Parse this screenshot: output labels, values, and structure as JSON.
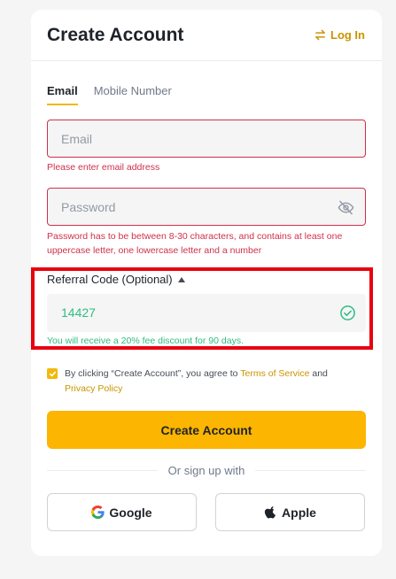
{
  "header": {
    "title": "Create Account",
    "login_label": "Log In",
    "login_icon": "swap-arrows-icon"
  },
  "tabs": [
    {
      "label": "Email",
      "active": true
    },
    {
      "label": "Mobile Number",
      "active": false
    }
  ],
  "email": {
    "value": "",
    "placeholder": "Email",
    "error": "Please enter email address"
  },
  "password": {
    "value": "",
    "placeholder": "Password",
    "error": "Password has to be between 8-30 characters, and contains at least one uppercase letter, one lowercase letter and a number",
    "toggle_icon": "eye-off-icon"
  },
  "referral": {
    "label": "Referral Code (Optional)",
    "value": "14427",
    "note": "You will receive a 20% fee discount for 90 days.",
    "status_icon": "check-circle-icon"
  },
  "agreement": {
    "checked": true,
    "text_before": "By clicking “Create Account”, you agree to ",
    "terms_label": "Terms of Service",
    "text_mid": " and ",
    "privacy_label": "Privacy Policy"
  },
  "submit_label": "Create Account",
  "divider_text": "Or sign up with",
  "social": [
    {
      "label": "Google",
      "icon": "google-icon"
    },
    {
      "label": "Apple",
      "icon": "apple-icon"
    }
  ],
  "colors": {
    "accent": "#fcb500",
    "link": "#c99400",
    "error": "#cf304a",
    "success": "#2ebd85",
    "highlight": "#e8000f"
  }
}
